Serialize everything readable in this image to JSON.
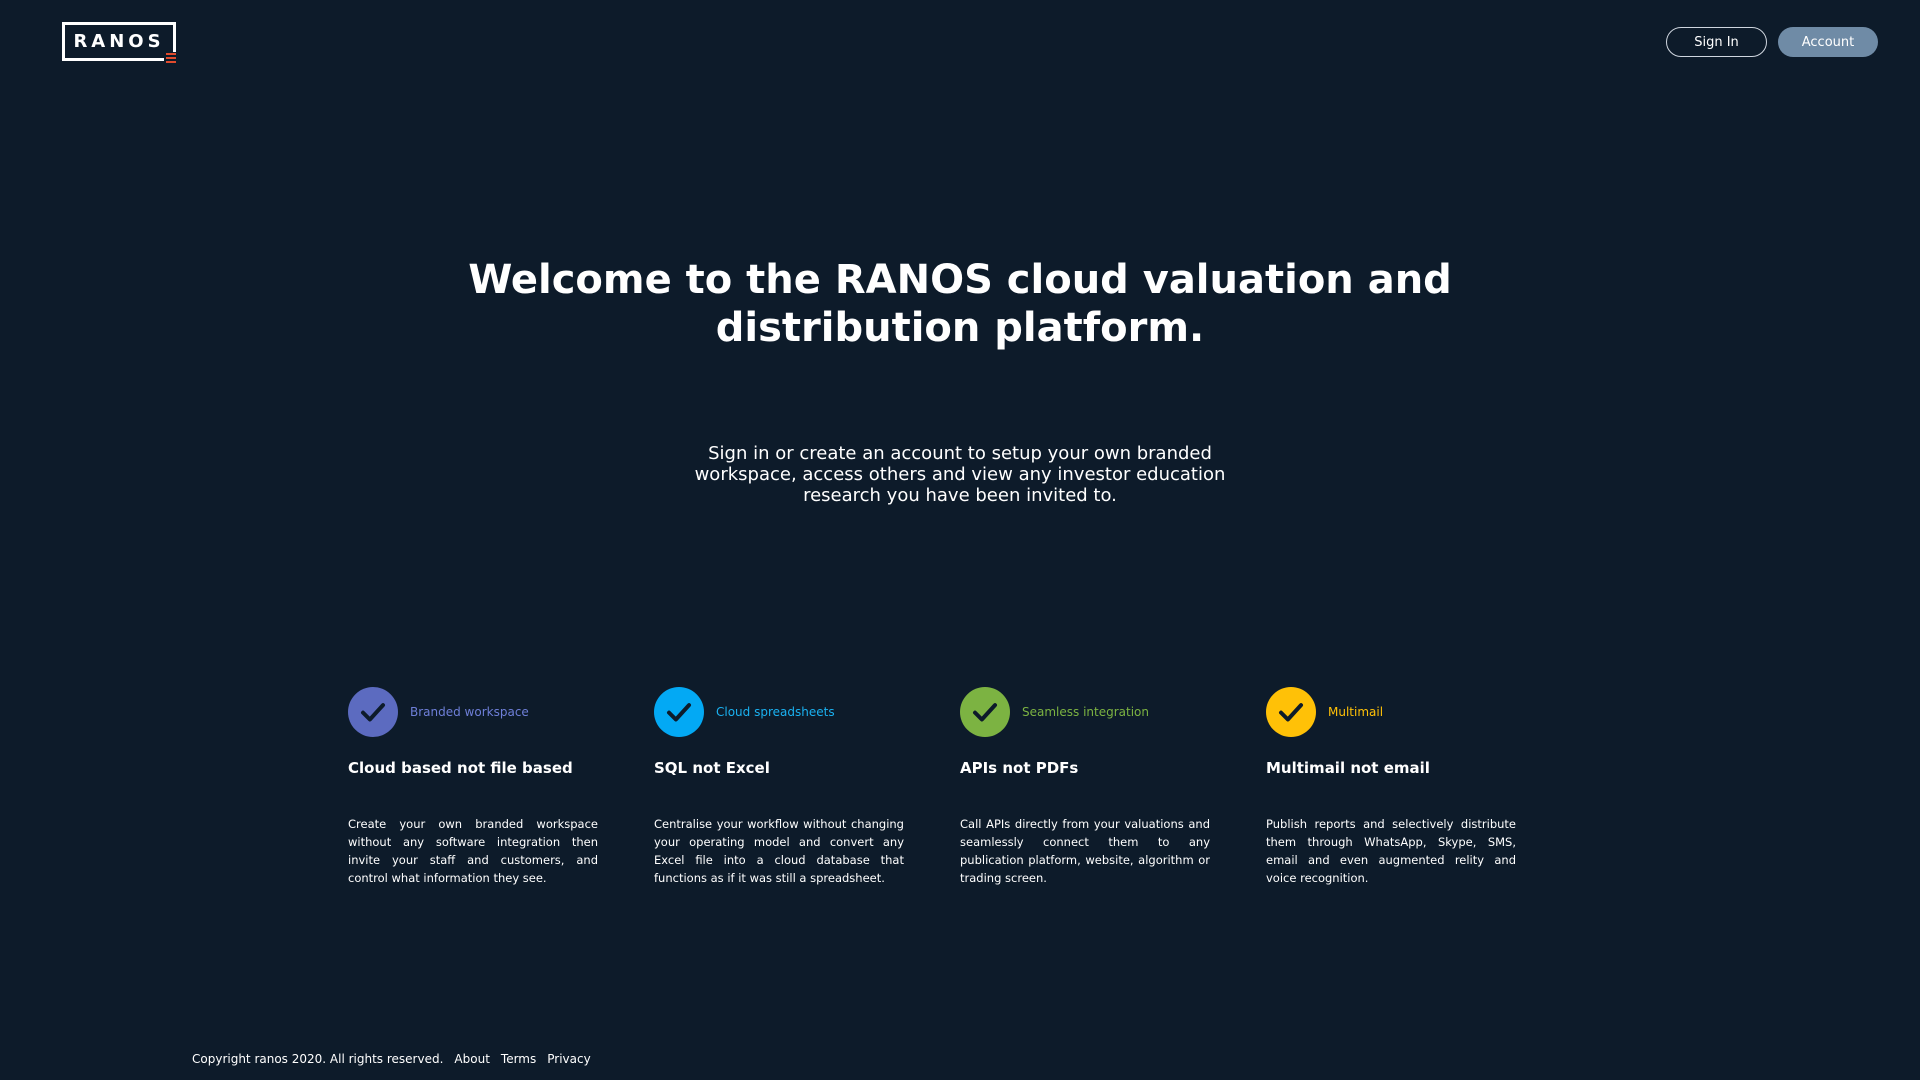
{
  "header": {
    "logo_text": "RANOS",
    "signin_label": "Sign In",
    "account_label": "Account"
  },
  "hero": {
    "title_line1": "Welcome to the RANOS cloud valuation and",
    "title_line2": "distribution platform.",
    "subtitle": "Sign in or create an account to setup your own branded workspace, access others and view any investor education research you have been invited to."
  },
  "features": [
    {
      "tag": "Branded workspace",
      "tag_color": "#6e7fd8",
      "icon_color": "#5c6bc0",
      "icon": "check-icon",
      "title": "Cloud based not file based",
      "description": "Create your own branded workspace without any software integration then invite your staff and customers, and control what information they see."
    },
    {
      "tag": "Cloud spreadsheets",
      "tag_color": "#1ab1f0",
      "icon_color": "#03a9f4",
      "icon": "check-icon",
      "title": "SQL not Excel",
      "description": "Centralise your workflow without changing your operating model and convert any Excel file into a cloud database that functions as if it was still a spreadsheet."
    },
    {
      "tag": "Seamless integration",
      "tag_color": "#7cb342",
      "icon_color": "#7cb342",
      "icon": "check-icon",
      "title": "APIs not PDFs",
      "description": "Call APIs directly from your valuations and seamlessly connect them to any publication platform, website, algorithm or trading screen."
    },
    {
      "tag": "Multimail",
      "tag_color": "#ffc107",
      "icon_color": "#ffc107",
      "icon": "check-icon",
      "title": "Multimail not email",
      "description": "Publish reports and selectively distribute them through WhatsApp, Skype, SMS, email and even augmented relity and voice recognition."
    }
  ],
  "footer": {
    "copyright": "Copyright ranos 2020. All rights reserved.",
    "about": "About",
    "terms": "Terms",
    "privacy": "Privacy"
  }
}
